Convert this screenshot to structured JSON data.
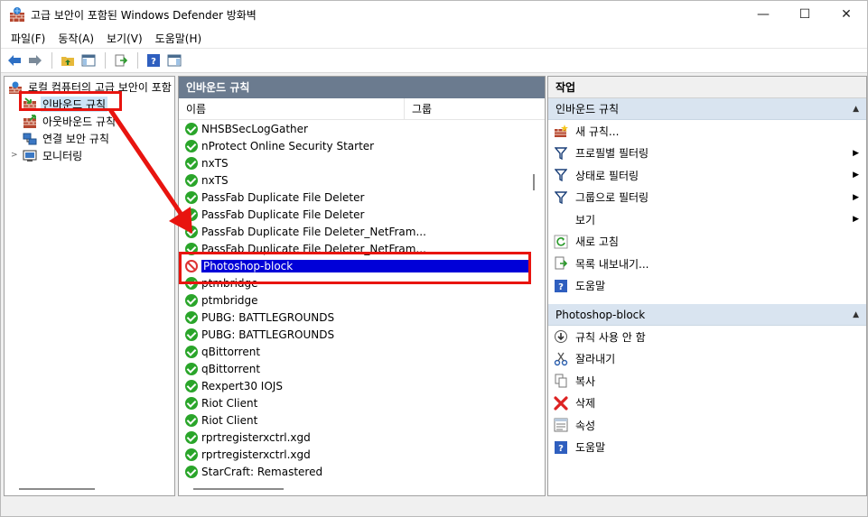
{
  "window": {
    "title": "고급 보안이 포함된 Windows Defender 방화벽",
    "minimize": "—",
    "maximize": "☐",
    "close": "✕"
  },
  "menu": {
    "items": [
      "파일(F)",
      "동작(A)",
      "보기(V)",
      "도움말(H)"
    ]
  },
  "tree": {
    "root": "로컬 컴퓨터의 고급 보안이 포함",
    "items": [
      {
        "label": "인바운드 규칙",
        "selected": true
      },
      {
        "label": "아웃바운드 규칙",
        "selected": false
      },
      {
        "label": "연결 보안 규칙",
        "selected": false
      },
      {
        "label": "모니터링",
        "selected": false
      }
    ]
  },
  "middle": {
    "header": "인바운드 규칙",
    "columns": {
      "name": "이름",
      "group": "그룹"
    },
    "rows": [
      {
        "name": "NHSBSecLogGather",
        "status": "ok"
      },
      {
        "name": "nProtect Online Security Starter",
        "status": "ok"
      },
      {
        "name": "nxTS",
        "status": "ok"
      },
      {
        "name": "nxTS",
        "status": "ok"
      },
      {
        "name": "PassFab Duplicate File Deleter",
        "status": "ok"
      },
      {
        "name": "PassFab Duplicate File Deleter",
        "status": "ok"
      },
      {
        "name": "PassFab Duplicate File Deleter_NetFram...",
        "status": "ok"
      },
      {
        "name": "PassFab Duplicate File Deleter_NetFram...",
        "status": "ok"
      },
      {
        "name": "Photoshop-block",
        "status": "blocked",
        "selected": true
      },
      {
        "name": "ptmbridge",
        "status": "ok"
      },
      {
        "name": "ptmbridge",
        "status": "ok"
      },
      {
        "name": "PUBG: BATTLEGROUNDS",
        "status": "ok"
      },
      {
        "name": "PUBG: BATTLEGROUNDS",
        "status": "ok"
      },
      {
        "name": "qBittorrent",
        "status": "ok"
      },
      {
        "name": "qBittorrent",
        "status": "ok"
      },
      {
        "name": "Rexpert30 IOJS",
        "status": "ok"
      },
      {
        "name": "Riot Client",
        "status": "ok"
      },
      {
        "name": "Riot Client",
        "status": "ok"
      },
      {
        "name": "rprtregisterxctrl.xgd",
        "status": "ok"
      },
      {
        "name": "rprtregisterxctrl.xgd",
        "status": "ok"
      },
      {
        "name": "StarCraft: Remastered",
        "status": "ok"
      }
    ]
  },
  "actions": {
    "header": "작업",
    "section1": {
      "title": "인바운드 규칙",
      "items": [
        {
          "label": "새 규칙...",
          "icon": "new-rule-icon",
          "submenu": false
        },
        {
          "label": "프로필별 필터링",
          "icon": "filter-icon",
          "submenu": true
        },
        {
          "label": "상태로 필터링",
          "icon": "filter-icon",
          "submenu": true
        },
        {
          "label": "그룹으로 필터링",
          "icon": "filter-icon",
          "submenu": true
        },
        {
          "label": "보기",
          "icon": "",
          "submenu": true
        },
        {
          "label": "새로 고침",
          "icon": "refresh-icon",
          "submenu": false
        },
        {
          "label": "목록 내보내기...",
          "icon": "export-icon",
          "submenu": false
        },
        {
          "label": "도움말",
          "icon": "help-icon",
          "submenu": false
        }
      ]
    },
    "section2": {
      "title": "Photoshop-block",
      "items": [
        {
          "label": "규칙 사용 안 함",
          "icon": "disable-icon"
        },
        {
          "label": "잘라내기",
          "icon": "cut-icon"
        },
        {
          "label": "복사",
          "icon": "copy-icon"
        },
        {
          "label": "삭제",
          "icon": "delete-icon"
        },
        {
          "label": "속성",
          "icon": "properties-icon"
        },
        {
          "label": "도움말",
          "icon": "help-icon"
        }
      ]
    }
  },
  "colors": {
    "selection": "#0000d8",
    "annotation": "#e8140f",
    "pane_header": "#6b7b8f",
    "allow_green": "#2aa52a"
  }
}
